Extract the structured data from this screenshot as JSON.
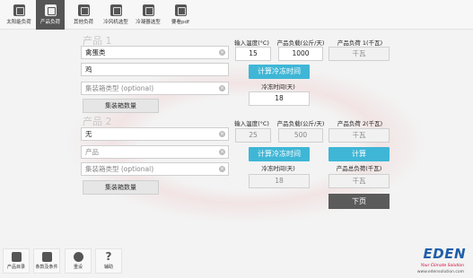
{
  "toolbar": {
    "items": [
      {
        "label": "太阳能负荷",
        "icon": "solar-icon",
        "active": false
      },
      {
        "label": "产品负荷",
        "icon": "product-load-icon",
        "active": true
      },
      {
        "label": "其他负荷",
        "icon": "other-load-icon",
        "active": false
      },
      {
        "label": "冷风机选型",
        "icon": "cooler-icon",
        "active": false
      },
      {
        "label": "冷凝器选型",
        "icon": "condenser-icon",
        "active": false
      },
      {
        "label": "要看pdf",
        "icon": "pdf-icon",
        "active": false
      }
    ]
  },
  "product1": {
    "title": "产品 1",
    "category": "禽蛋类",
    "product": "鸡",
    "container_type_placeholder": "集装箱类型 (optional)",
    "container_qty_label": "集装箱数量",
    "input_temp_label": "输入温度(°C)",
    "input_temp_value": "15",
    "load_label": "产品负载(公斤/天)",
    "load_value": "1000",
    "calc_freeze_button": "计算冷冻时间",
    "freeze_time_label": "冷冻时间(天)",
    "freeze_time_value": "18",
    "product_load_label": "产品负荷 1(千瓦)",
    "product_load_placeholder": "千瓦"
  },
  "product2": {
    "title": "产品 2",
    "category": "无",
    "product_placeholder": "产品",
    "container_type_placeholder": "集装箱类型 (optional)",
    "container_qty_label": "集装箱数量",
    "input_temp_label": "输入温度(°C)",
    "input_temp_value": "25",
    "load_label": "产品负载(公斤/天)",
    "load_value": "500",
    "calc_freeze_button": "计算冷冻时间",
    "freeze_time_label": "冷冻时间(天)",
    "freeze_time_value": "18",
    "product_load_label": "产品负荷 2(千瓦)",
    "product_load_placeholder": "千瓦"
  },
  "calc_button": "计算",
  "total_load_label": "产品总负荷(千瓦)",
  "total_load_placeholder": "千瓦",
  "next_button": "下页",
  "bottom": {
    "items": [
      {
        "label": "产品目录",
        "icon": "catalog-icon"
      },
      {
        "label": "条款及条件",
        "icon": "terms-icon"
      },
      {
        "label": "重设",
        "icon": "reset-icon"
      },
      {
        "label": "辅助",
        "icon": "help-icon"
      }
    ],
    "brand": "EDEN",
    "tagline": "Your Climate Solution",
    "url": "www.edensolution.com"
  },
  "colors": {
    "accent": "#3fb6d6",
    "dark_button": "#5b5b5b",
    "brand": "#1f5fa8"
  }
}
